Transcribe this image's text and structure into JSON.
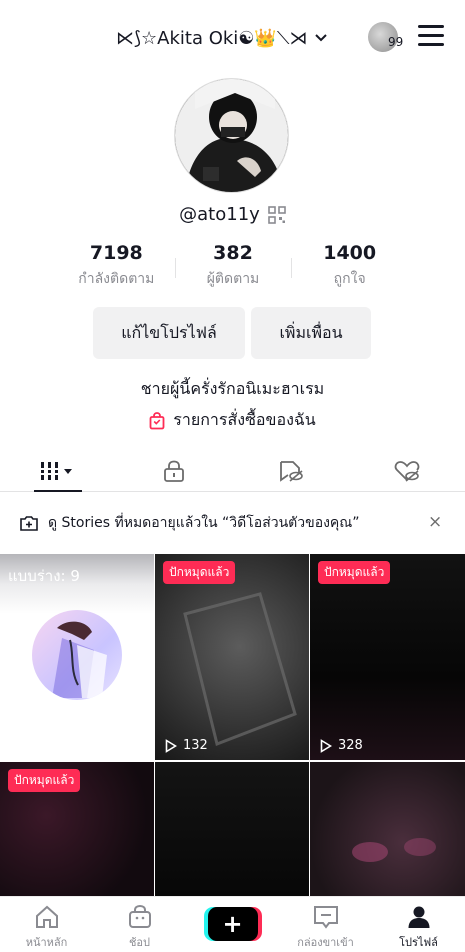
{
  "header": {
    "username": "⋉⟆☆Akita Oki☯👑⟍⋊",
    "story_count": "99"
  },
  "profile": {
    "handle": "@ato11y",
    "stats": [
      {
        "value": "7198",
        "label": "กำลังติดตาม"
      },
      {
        "value": "382",
        "label": "ผู้ติดตาม"
      },
      {
        "value": "1400",
        "label": "ถูกใจ"
      }
    ],
    "edit_button": "แก้ไขโปรไฟล์",
    "add_friend_button": "เพิ่มเพื่อน",
    "bio": "ชายผู้นี้ครั่งรักอนิเมะฮาเรม",
    "orders_link": "รายการสั่งซื้อของฉัน"
  },
  "notice": {
    "text": "ดู Stories ที่หมดอายุแล้วใน “วิดีโอส่วนตัวของคุณ”",
    "close": "×"
  },
  "grid": {
    "drafts_label": "แบบร่าง: 9",
    "items": [
      {
        "pinned": "ปักหมุดแล้ว",
        "views": "132"
      },
      {
        "pinned": "ปักหมุดแล้ว",
        "views": "328"
      },
      {
        "pinned": "ปักหมุดแล้ว"
      }
    ]
  },
  "bottom_nav": {
    "home": "หน้าหลัก",
    "shop": "ช้อป",
    "create": "+",
    "inbox": "กล่องขาเข้า",
    "profile": "โปรไฟล์"
  },
  "colors": {
    "accent": "#fe2c55",
    "cyan": "#25f4ee",
    "text": "#161823",
    "muted": "#8a8b91"
  }
}
